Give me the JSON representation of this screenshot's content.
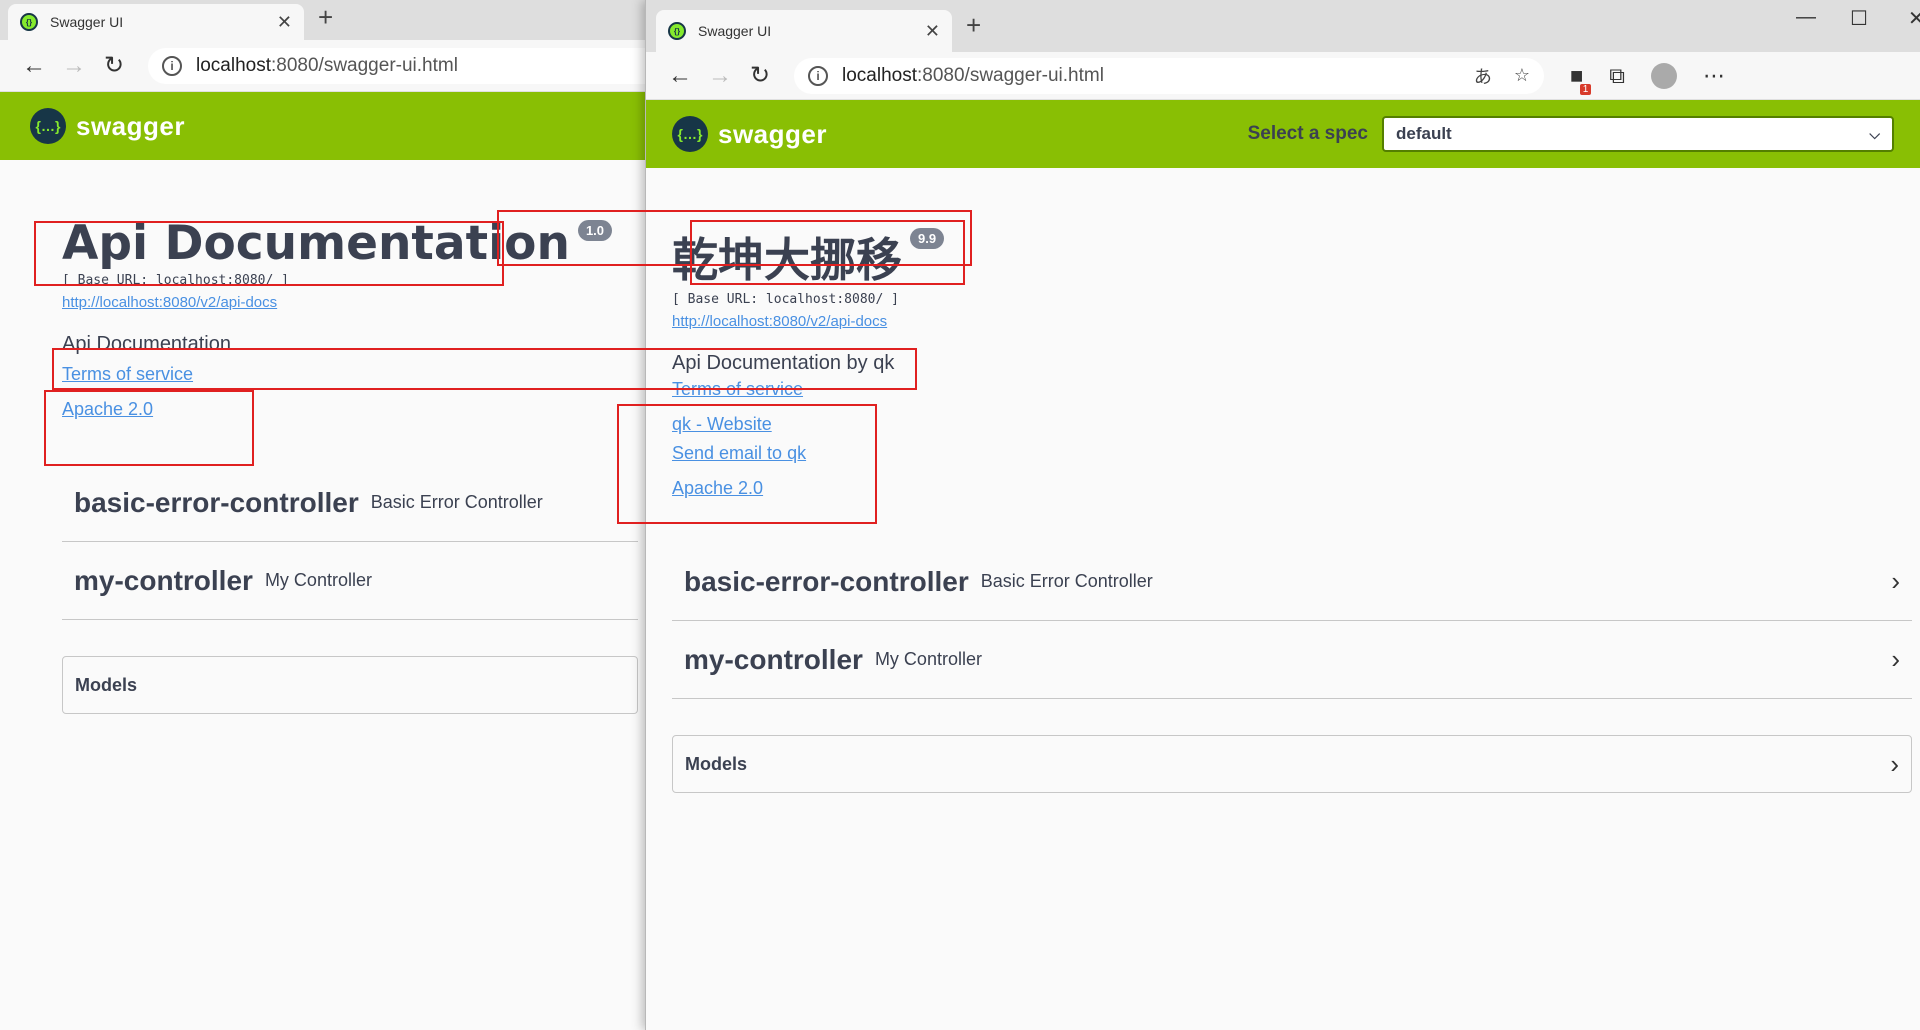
{
  "left_window": {
    "tab_title": "Swagger UI",
    "url_host": "localhost",
    "url_rest": ":8080/swagger-ui.html",
    "brand": "swagger",
    "title": "Api Documentation",
    "version": "1.0",
    "base_url": "[ Base URL: localhost:8080/ ]",
    "api_docs_link": "http://localhost:8080/v2/api-docs",
    "description": "Api Documentation",
    "links": [
      "Terms of service",
      "Apache 2.0"
    ],
    "controllers": [
      {
        "name": "basic-error-controller",
        "desc": "Basic Error Controller"
      },
      {
        "name": "my-controller",
        "desc": "My Controller"
      }
    ],
    "models_label": "Models"
  },
  "right_window": {
    "tab_title": "Swagger UI",
    "url_host": "localhost",
    "url_rest": ":8080/swagger-ui.html",
    "brand": "swagger",
    "spec_label": "Select a spec",
    "spec_value": "default",
    "title": "乾坤大挪移",
    "version": "9.9",
    "base_url": "[ Base URL: localhost:8080/ ]",
    "api_docs_link": "http://localhost:8080/v2/api-docs",
    "description": "Api Documentation by qk",
    "links": [
      "Terms of service",
      "qk - Website",
      "Send email to qk",
      "Apache 2.0"
    ],
    "controllers": [
      {
        "name": "basic-error-controller",
        "desc": "Basic Error Controller"
      },
      {
        "name": "my-controller",
        "desc": "My Controller"
      }
    ],
    "models_label": "Models",
    "extension_badge": "1"
  },
  "icons": {
    "back": "back-arrow-icon",
    "forward": "forward-arrow-icon",
    "refresh": "refresh-icon",
    "close_tab": "close-icon",
    "new_tab": "plus-icon",
    "chevron": "chevron-right-icon"
  },
  "colors": {
    "swagger_green": "#89bf04",
    "link_blue": "#4990e2",
    "annotation_red": "#e02020"
  }
}
